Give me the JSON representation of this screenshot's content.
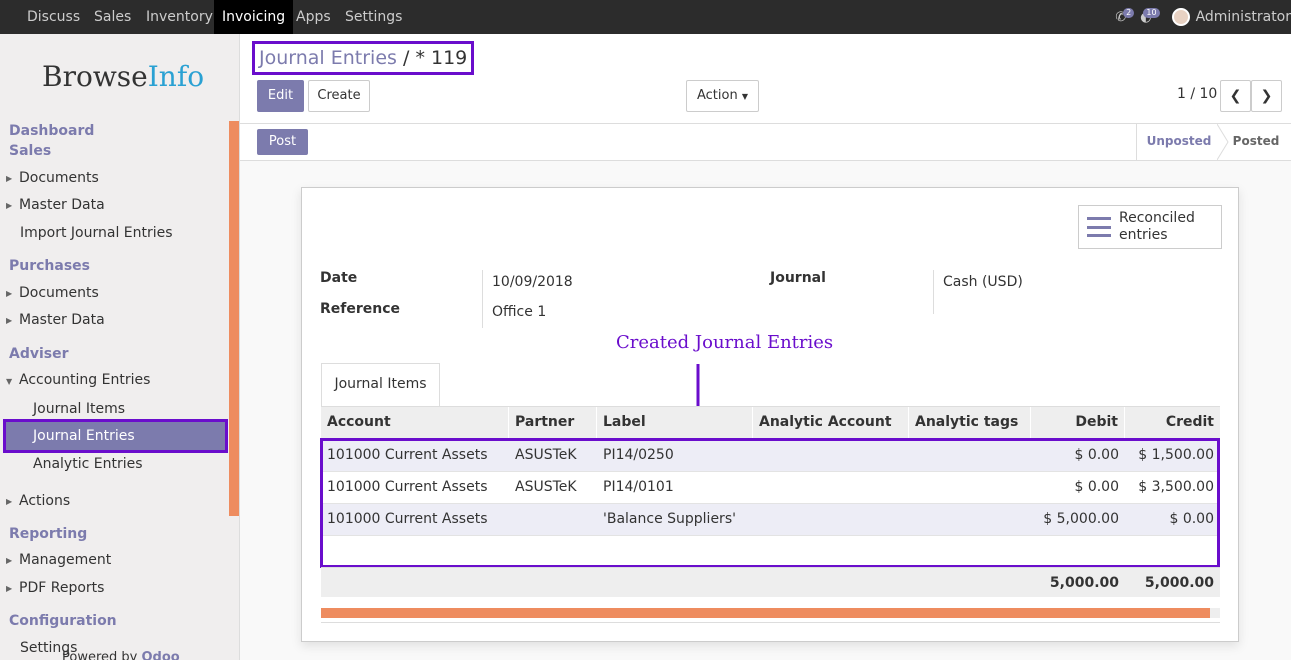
{
  "topbar": {
    "menu": [
      "Discuss",
      "Sales",
      "Inventory",
      "Invoicing",
      "Apps",
      "Settings"
    ],
    "active": "Invoicing",
    "chat_badge": "2",
    "activity_badge": "10",
    "user": "Administrator"
  },
  "sidebar": {
    "logo_browse": "Browse",
    "logo_info": "Info",
    "dashboard": "Dashboard",
    "sales": "Sales",
    "sales_documents": "Documents",
    "sales_master_data": "Master Data",
    "import_journal_entries": "Import Journal Entries",
    "purchases": "Purchases",
    "purch_documents": "Documents",
    "purch_master_data": "Master Data",
    "adviser": "Adviser",
    "accounting_entries": "Accounting Entries",
    "journal_items": "Journal Items",
    "journal_entries": "Journal Entries",
    "analytic_entries": "Analytic Entries",
    "actions": "Actions",
    "reporting": "Reporting",
    "management": "Management",
    "pdf_reports": "PDF Reports",
    "configuration": "Configuration",
    "settings": "Settings",
    "powered_by": "Powered by ",
    "odoo": "Odoo"
  },
  "control": {
    "breadcrumb_parent": "Journal Entries",
    "breadcrumb_sep": "/",
    "breadcrumb_current": "* 119",
    "edit": "Edit",
    "create": "Create",
    "action": "Action",
    "pager": "1 / 10"
  },
  "status": {
    "post": "Post",
    "unposted": "Unposted",
    "posted": "Posted"
  },
  "form": {
    "reconciled_label": "Reconciled entries",
    "date_label": "Date",
    "date_value": "10/09/2018",
    "reference_label": "Reference",
    "reference_value": "Office 1",
    "journal_label": "Journal",
    "journal_value": "Cash (USD)",
    "annotation": "Created Journal Entries",
    "tab": "Journal Items"
  },
  "table": {
    "headers": [
      "Account",
      "Partner",
      "Label",
      "Analytic Account",
      "Analytic tags",
      "Debit",
      "Credit"
    ],
    "rows": [
      {
        "account": "101000 Current Assets",
        "partner": "ASUSTeK",
        "label": "PI14/0250",
        "analytic_account": "",
        "analytic_tags": "",
        "debit": "$ 0.00",
        "credit": "$ 1,500.00"
      },
      {
        "account": "101000 Current Assets",
        "partner": "ASUSTeK",
        "label": "PI14/0101",
        "analytic_account": "",
        "analytic_tags": "",
        "debit": "$ 0.00",
        "credit": "$ 3,500.00"
      },
      {
        "account": "101000 Current Assets",
        "partner": "",
        "label": "'Balance Suppliers'",
        "analytic_account": "",
        "analytic_tags": "",
        "debit": "$ 5,000.00",
        "credit": "$ 0.00"
      }
    ],
    "total_debit": "5,000.00",
    "total_credit": "5,000.00"
  },
  "colors": {
    "accent": "#7c7bad",
    "highlight": "#6a0dcc",
    "scrollbar": "#ee8c5f"
  }
}
